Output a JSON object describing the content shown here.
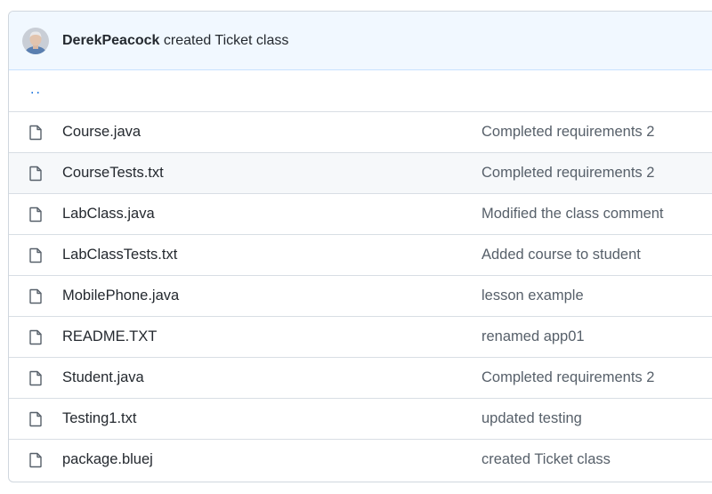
{
  "latest_commit": {
    "author": "DerekPeacock",
    "message": "created Ticket class"
  },
  "parent_dir_link": "..",
  "files": [
    {
      "name": "Course.java",
      "commit": "Completed requirements 2"
    },
    {
      "name": "CourseTests.txt",
      "commit": "Completed requirements 2"
    },
    {
      "name": "LabClass.java",
      "commit": "Modified the class comment"
    },
    {
      "name": "LabClassTests.txt",
      "commit": "Added course to student"
    },
    {
      "name": "MobilePhone.java",
      "commit": "lesson example"
    },
    {
      "name": "README.TXT",
      "commit": "renamed app01"
    },
    {
      "name": "Student.java",
      "commit": "Completed requirements 2"
    },
    {
      "name": "Testing1.txt",
      "commit": "updated testing"
    },
    {
      "name": "package.bluej",
      "commit": "created Ticket class"
    }
  ],
  "icons": {
    "file": "file-icon",
    "avatar": "user-avatar"
  },
  "colors": {
    "header_bg": "#f1f8ff",
    "link": "#0969da",
    "row_hover": "#f6f8fa"
  }
}
